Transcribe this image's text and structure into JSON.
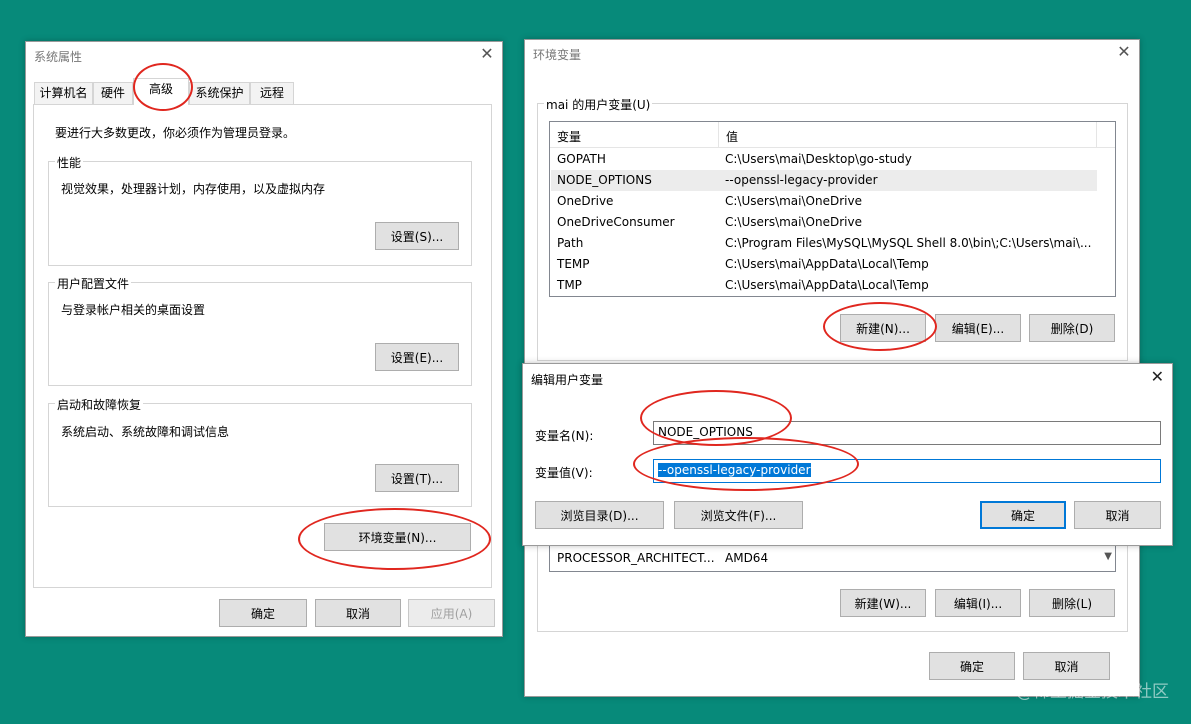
{
  "sys_props": {
    "title": "系统属性",
    "tabs": [
      "计算机名",
      "硬件",
      "高级",
      "系统保护",
      "远程"
    ],
    "admin_note": "要进行大多数更改，你必须作为管理员登录。",
    "performance": {
      "label": "性能",
      "desc": "视觉效果，处理器计划，内存使用，以及虚拟内存",
      "button": "设置(S)..."
    },
    "profiles": {
      "label": "用户配置文件",
      "desc": "与登录帐户相关的桌面设置",
      "button": "设置(E)..."
    },
    "startup": {
      "label": "启动和故障恢复",
      "desc": "系统启动、系统故障和调试信息",
      "button": "设置(T)..."
    },
    "env_button": "环境变量(N)...",
    "ok": "确定",
    "cancel": "取消",
    "apply": "应用(A)"
  },
  "env_vars": {
    "title": "环境变量",
    "user_group_label": "mai 的用户变量(U)",
    "columns": {
      "name": "变量",
      "value": "值"
    },
    "user_rows": [
      {
        "name": "GOPATH",
        "value": "C:\\Users\\mai\\Desktop\\go-study"
      },
      {
        "name": "NODE_OPTIONS",
        "value": "--openssl-legacy-provider"
      },
      {
        "name": "OneDrive",
        "value": "C:\\Users\\mai\\OneDrive"
      },
      {
        "name": "OneDriveConsumer",
        "value": "C:\\Users\\mai\\OneDrive"
      },
      {
        "name": "Path",
        "value": "C:\\Program Files\\MySQL\\MySQL Shell 8.0\\bin\\;C:\\Users\\mai\\..."
      },
      {
        "name": "TEMP",
        "value": "C:\\Users\\mai\\AppData\\Local\\Temp"
      },
      {
        "name": "TMP",
        "value": "C:\\Users\\mai\\AppData\\Local\\Temp"
      }
    ],
    "user_buttons": {
      "new": "新建(N)...",
      "edit": "编辑(E)...",
      "delete": "删除(D)"
    },
    "system_row": {
      "name": "PROCESSOR_ARCHITECT...",
      "value": "AMD64"
    },
    "system_buttons": {
      "new": "新建(W)...",
      "edit": "编辑(I)...",
      "delete": "删除(L)"
    },
    "ok": "确定",
    "cancel": "取消"
  },
  "edit_dialog": {
    "title": "编辑用户变量",
    "name_label": "变量名(N):",
    "value_label": "变量值(V):",
    "name_value": "NODE_OPTIONS",
    "value_value": "--openssl-legacy-provider",
    "browse_dir": "浏览目录(D)...",
    "browse_file": "浏览文件(F)...",
    "ok": "确定",
    "cancel": "取消"
  },
  "watermark": "@稀土掘金技术社区",
  "annotation_color": "#e0271f"
}
